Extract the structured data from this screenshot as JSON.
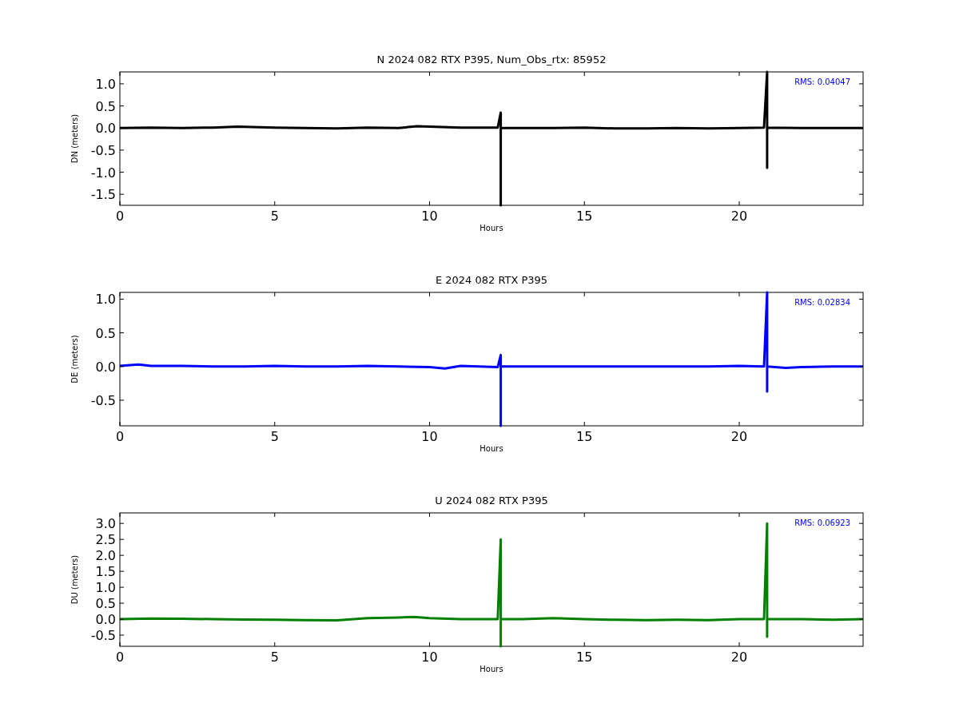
{
  "charts": [
    {
      "chart_data": {
        "type": "line",
        "title": "N 2024 082 RTX  P395, Num_Obs_rtx: 85952",
        "xlabel": "Hours",
        "ylabel": "DN (meters)",
        "xlim": [
          0,
          24
        ],
        "ylim": [
          -1.75,
          1.27
        ],
        "xticks": [
          0,
          5,
          10,
          15,
          20
        ],
        "yticks": [
          {
            "value": -1.5,
            "label": "-1.5"
          },
          {
            "value": -1,
            "label": "-1.0"
          },
          {
            "value": -0.5,
            "label": "-0.5"
          },
          {
            "value": 0,
            "label": "0.0"
          },
          {
            "value": 0.5,
            "label": "0.5"
          },
          {
            "value": 1,
            "label": "1.0"
          }
        ],
        "x": [
          0,
          1,
          2,
          3,
          3.8,
          5,
          6,
          7,
          8,
          9,
          9.6,
          10,
          11,
          12.2,
          12.3,
          12.3,
          12.3,
          12.3,
          12.3,
          13,
          14,
          15,
          16,
          17,
          18,
          19,
          20,
          20.8,
          20.9,
          20.9,
          20.9,
          20.9,
          20.9,
          22,
          23,
          24
        ],
        "series": [
          {
            "color": "#000000",
            "values": [
              0,
              0.01,
              0,
              0.01,
              0.03,
              0.01,
              0,
              -0.01,
              0.01,
              0,
              0.04,
              0.03,
              0.01,
              0.01,
              0.35,
              -0.1,
              -1.75,
              -1.3,
              0,
              0,
              0,
              0.01,
              -0.01,
              -0.01,
              0,
              -0.01,
              0,
              0.01,
              1.27,
              -0.9,
              0.65,
              0,
              0.01,
              0,
              0,
              0
            ]
          }
        ],
        "annotations": [
          {
            "text": "RMS:  0.04047"
          }
        ]
      }
    },
    {
      "chart_data": {
        "type": "line",
        "title": "E 2024 082 RTX  P395",
        "xlabel": "Hours",
        "ylabel": "DE (meters)",
        "xlim": [
          0,
          24
        ],
        "ylim": [
          -0.88,
          1.1
        ],
        "xticks": [
          0,
          5,
          10,
          15,
          20
        ],
        "yticks": [
          {
            "value": -0.5,
            "label": "-0.5"
          },
          {
            "value": 0,
            "label": "0.0"
          },
          {
            "value": 0.5,
            "label": "0.5"
          },
          {
            "value": 1,
            "label": "1.0"
          }
        ],
        "x": [
          0,
          0.6,
          1,
          2,
          3,
          4,
          5,
          6,
          7,
          8,
          9,
          10,
          10.5,
          11,
          12.2,
          12.3,
          12.3,
          12.3,
          12.3,
          13,
          14,
          15,
          16,
          17,
          18,
          19,
          20,
          20.8,
          20.9,
          20.9,
          20.9,
          20.9,
          21.5,
          22,
          23,
          24
        ],
        "series": [
          {
            "color": "#0000ff",
            "values": [
              0.01,
              0.03,
              0.01,
              0.01,
              0,
              0,
              0.01,
              0,
              0,
              0.01,
              0,
              -0.01,
              -0.03,
              0.01,
              -0.01,
              0.17,
              -0.88,
              -0.7,
              0,
              0,
              0,
              0,
              0,
              0,
              0,
              0,
              0.01,
              0,
              1.1,
              -0.37,
              0.4,
              0,
              -0.02,
              -0.01,
              0,
              0
            ]
          }
        ],
        "annotations": [
          {
            "text": "RMS:  0.02834"
          }
        ]
      }
    },
    {
      "chart_data": {
        "type": "line",
        "title": "U 2024 082 RTX  P395",
        "xlabel": "Hours",
        "ylabel": "DU (meters)",
        "xlim": [
          0,
          24
        ],
        "ylim": [
          -0.85,
          3.33
        ],
        "xticks": [
          0,
          5,
          10,
          15,
          20
        ],
        "yticks": [
          {
            "value": -0.5,
            "label": "-0.5"
          },
          {
            "value": 0,
            "label": "0.0"
          },
          {
            "value": 0.5,
            "label": "0.5"
          },
          {
            "value": 1,
            "label": "1.0"
          },
          {
            "value": 1.5,
            "label": "1.5"
          },
          {
            "value": 2,
            "label": "2.0"
          },
          {
            "value": 2.5,
            "label": "2.5"
          },
          {
            "value": 3,
            "label": "3.0"
          }
        ],
        "x": [
          0,
          1,
          2,
          3,
          4,
          5,
          6,
          7,
          8,
          9,
          9.5,
          10,
          11,
          12.2,
          12.3,
          12.3,
          12.3,
          12.3,
          12.3,
          13,
          14,
          15,
          16,
          17,
          18,
          19,
          20,
          20.8,
          20.9,
          20.9,
          20.9,
          20.9,
          20.9,
          22,
          23,
          24
        ],
        "series": [
          {
            "color": "#008000",
            "values": [
              0,
              0.02,
              0.01,
              0,
              -0.01,
              -0.02,
              -0.03,
              -0.04,
              0.03,
              0.05,
              0.07,
              0.03,
              0,
              0,
              2.5,
              1.9,
              0.15,
              -0.85,
              0,
              0,
              0.03,
              0,
              -0.02,
              -0.03,
              -0.02,
              -0.03,
              0,
              0,
              3.0,
              -0.55,
              1.4,
              0,
              0,
              0,
              -0.02,
              0
            ]
          }
        ],
        "annotations": [
          {
            "text": "RMS:  0.06923"
          }
        ]
      }
    }
  ]
}
